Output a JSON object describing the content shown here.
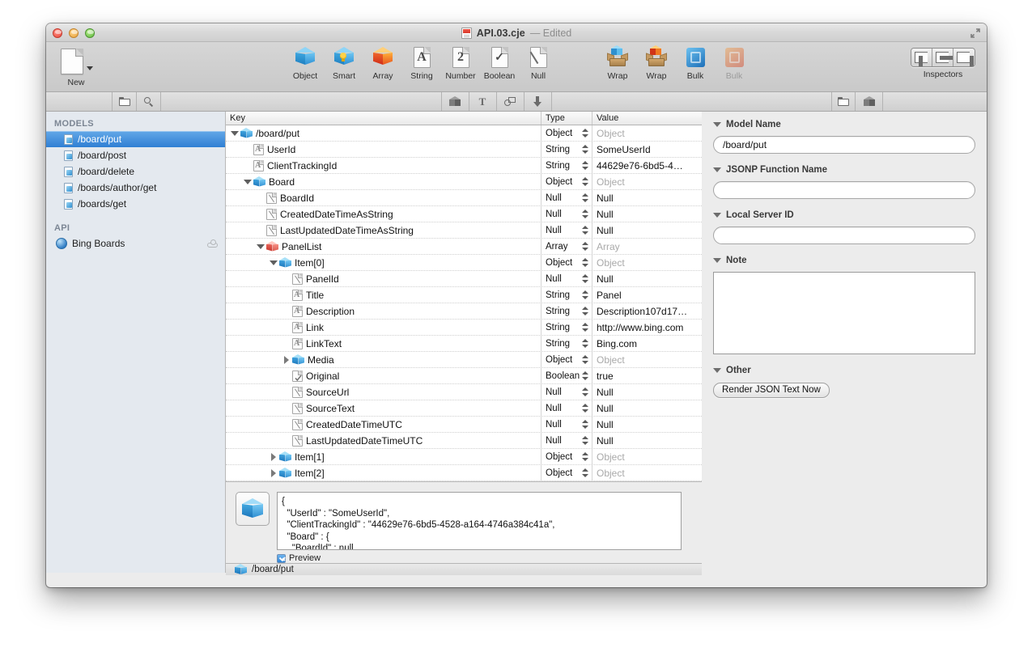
{
  "window": {
    "title": "API.03.cje",
    "title_suffix": "— Edited",
    "doc_icon": "document-icon",
    "fullscreen_icon": "fullscreen-icon"
  },
  "toolbar": {
    "new_label": "New",
    "items": [
      {
        "label": "Object",
        "icon": "object-cube-icon",
        "disabled": false
      },
      {
        "label": "Smart",
        "icon": "smart-cube-icon",
        "disabled": false
      },
      {
        "label": "Array",
        "icon": "array-cube-icon",
        "disabled": false
      },
      {
        "label": "String",
        "icon": "string-page-icon",
        "disabled": false
      },
      {
        "label": "Number",
        "icon": "number-page-icon",
        "disabled": false
      },
      {
        "label": "Boolean",
        "icon": "boolean-page-icon",
        "disabled": false
      },
      {
        "label": "Null",
        "icon": "null-page-icon",
        "disabled": false
      },
      {
        "label": "Wrap",
        "icon": "wrap-object-icon",
        "disabled": false
      },
      {
        "label": "Wrap",
        "icon": "wrap-array-icon",
        "disabled": false
      },
      {
        "label": "Bulk",
        "icon": "bulk-object-icon",
        "disabled": false
      },
      {
        "label": "Bulk",
        "icon": "bulk-array-icon",
        "disabled": true
      }
    ],
    "inspectors_label": "Inspectors"
  },
  "filterbar": {
    "icons": [
      "folder-icon",
      "search-icon",
      "cube-icon",
      "text-icon",
      "shapes-icon",
      "download-icon"
    ],
    "right_icons": [
      "folder-icon",
      "cube-icon"
    ]
  },
  "sidebar": {
    "models_header": "MODELS",
    "models": [
      {
        "label": "/board/put",
        "selected": true
      },
      {
        "label": "/board/post",
        "selected": false
      },
      {
        "label": "/board/delete",
        "selected": false
      },
      {
        "label": "/boards/author/get",
        "selected": false
      },
      {
        "label": "/boards/get",
        "selected": false
      }
    ],
    "api_header": "API",
    "api_items": [
      {
        "label": "Bing Boards",
        "icon": "globe-icon",
        "trailing_icon": "cloud-icon"
      }
    ]
  },
  "outline": {
    "columns": [
      "Key",
      "Type",
      "Value"
    ],
    "rows": [
      {
        "key": "/board/put",
        "depth": 0,
        "twisty": "open",
        "icon": "object-cube-icon",
        "type": "Object",
        "value": "Object",
        "placeholder": true
      },
      {
        "key": "UserId",
        "depth": 1,
        "twisty": "none",
        "icon": "string-page-icon",
        "type": "String",
        "value": "SomeUserId",
        "placeholder": false
      },
      {
        "key": "ClientTrackingId",
        "depth": 1,
        "twisty": "none",
        "icon": "string-page-icon",
        "type": "String",
        "value": "44629e76-6bd5-4…",
        "placeholder": false
      },
      {
        "key": "Board",
        "depth": 1,
        "twisty": "open",
        "icon": "object-cube-icon",
        "type": "Object",
        "value": "Object",
        "placeholder": true
      },
      {
        "key": "BoardId",
        "depth": 2,
        "twisty": "none",
        "icon": "null-page-icon",
        "type": "Null",
        "value": "Null",
        "placeholder": false
      },
      {
        "key": "CreatedDateTimeAsString",
        "depth": 2,
        "twisty": "none",
        "icon": "null-page-icon",
        "type": "Null",
        "value": "Null",
        "placeholder": false
      },
      {
        "key": "LastUpdatedDateTimeAsString",
        "depth": 2,
        "twisty": "none",
        "icon": "null-page-icon",
        "type": "Null",
        "value": "Null",
        "placeholder": false
      },
      {
        "key": "PanelList",
        "depth": 2,
        "twisty": "open",
        "icon": "array-cube-icon",
        "type": "Array",
        "value": "Array",
        "placeholder": true
      },
      {
        "key": "Item[0]",
        "depth": 3,
        "twisty": "open",
        "icon": "object-cube-icon",
        "type": "Object",
        "value": "Object",
        "placeholder": true
      },
      {
        "key": "PanelId",
        "depth": 4,
        "twisty": "none",
        "icon": "null-page-icon",
        "type": "Null",
        "value": "Null",
        "placeholder": false
      },
      {
        "key": "Title",
        "depth": 4,
        "twisty": "none",
        "icon": "string-page-icon",
        "type": "String",
        "value": "Panel",
        "placeholder": false
      },
      {
        "key": "Description",
        "depth": 4,
        "twisty": "none",
        "icon": "string-page-icon",
        "type": "String",
        "value": "Description107d17…",
        "placeholder": false
      },
      {
        "key": "Link",
        "depth": 4,
        "twisty": "none",
        "icon": "string-page-icon",
        "type": "String",
        "value": "http://www.bing.com",
        "placeholder": false
      },
      {
        "key": "LinkText",
        "depth": 4,
        "twisty": "none",
        "icon": "string-page-icon",
        "type": "String",
        "value": "Bing.com",
        "placeholder": false
      },
      {
        "key": "Media",
        "depth": 4,
        "twisty": "closed",
        "icon": "object-cube-icon",
        "type": "Object",
        "value": "Object",
        "placeholder": true
      },
      {
        "key": "Original",
        "depth": 4,
        "twisty": "none",
        "icon": "boolean-page-icon",
        "type": "Boolean",
        "value": "true",
        "placeholder": false
      },
      {
        "key": "SourceUrl",
        "depth": 4,
        "twisty": "none",
        "icon": "null-page-icon",
        "type": "Null",
        "value": "Null",
        "placeholder": false
      },
      {
        "key": "SourceText",
        "depth": 4,
        "twisty": "none",
        "icon": "null-page-icon",
        "type": "Null",
        "value": "Null",
        "placeholder": false
      },
      {
        "key": "CreatedDateTimeUTC",
        "depth": 4,
        "twisty": "none",
        "icon": "null-page-icon",
        "type": "Null",
        "value": "Null",
        "placeholder": false
      },
      {
        "key": "LastUpdatedDateTimeUTC",
        "depth": 4,
        "twisty": "none",
        "icon": "null-page-icon",
        "type": "Null",
        "value": "Null",
        "placeholder": false
      },
      {
        "key": "Item[1]",
        "depth": 3,
        "twisty": "closed",
        "icon": "object-cube-icon",
        "type": "Object",
        "value": "Object",
        "placeholder": true
      },
      {
        "key": "Item[2]",
        "depth": 3,
        "twisty": "closed",
        "icon": "object-cube-icon",
        "type": "Object",
        "value": "Object",
        "placeholder": true
      }
    ]
  },
  "preview": {
    "json_text": "{\n  \"UserId\" : \"SomeUserId\",\n  \"ClientTrackingId\" : \"44629e76-6bd5-4528-a164-4746a384c41a\",\n  \"Board\" : {\n    \"BoardId\" : null,",
    "checkbox_label": "Preview",
    "checked": true
  },
  "statusbar": {
    "path": "/board/put",
    "icon": "object-cube-icon"
  },
  "inspector": {
    "sections": [
      {
        "title": "Model Name",
        "value": "/board/put"
      },
      {
        "title": "JSONP Function Name",
        "value": ""
      },
      {
        "title": "Local Server ID",
        "value": ""
      },
      {
        "title": "Note",
        "value": ""
      },
      {
        "title": "Other",
        "value": ""
      }
    ],
    "render_button": "Render JSON Text Now"
  },
  "colors": {
    "selection_blue": "#2f7fd4",
    "window_chrome": "#d2d2d2",
    "sidebar_bg": "#e4e9ef",
    "placeholder_gray": "#a9a9a9"
  }
}
